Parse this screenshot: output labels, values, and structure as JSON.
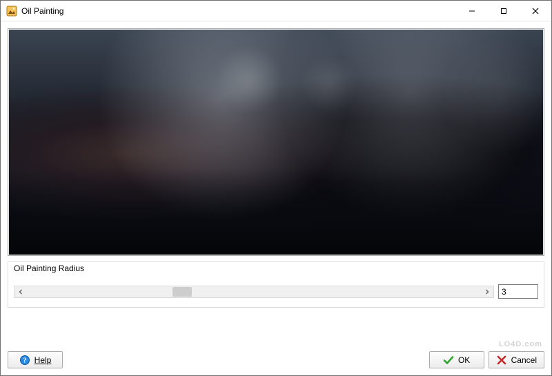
{
  "window": {
    "title": "Oil Painting"
  },
  "group": {
    "label": "Oil Painting Radius",
    "value": "3",
    "thumb_left_percent": 32
  },
  "buttons": {
    "help": "Help",
    "ok": "OK",
    "cancel": "Cancel"
  },
  "icons": {
    "app": "app-icon",
    "minimize": "minimize-icon",
    "maximize": "maximize-icon",
    "close": "close-icon",
    "help": "help-icon",
    "ok": "check-icon",
    "cancel": "cross-icon",
    "arrow_left": "arrow-left-icon",
    "arrow_right": "arrow-right-icon"
  },
  "watermark": "LO4D.com"
}
